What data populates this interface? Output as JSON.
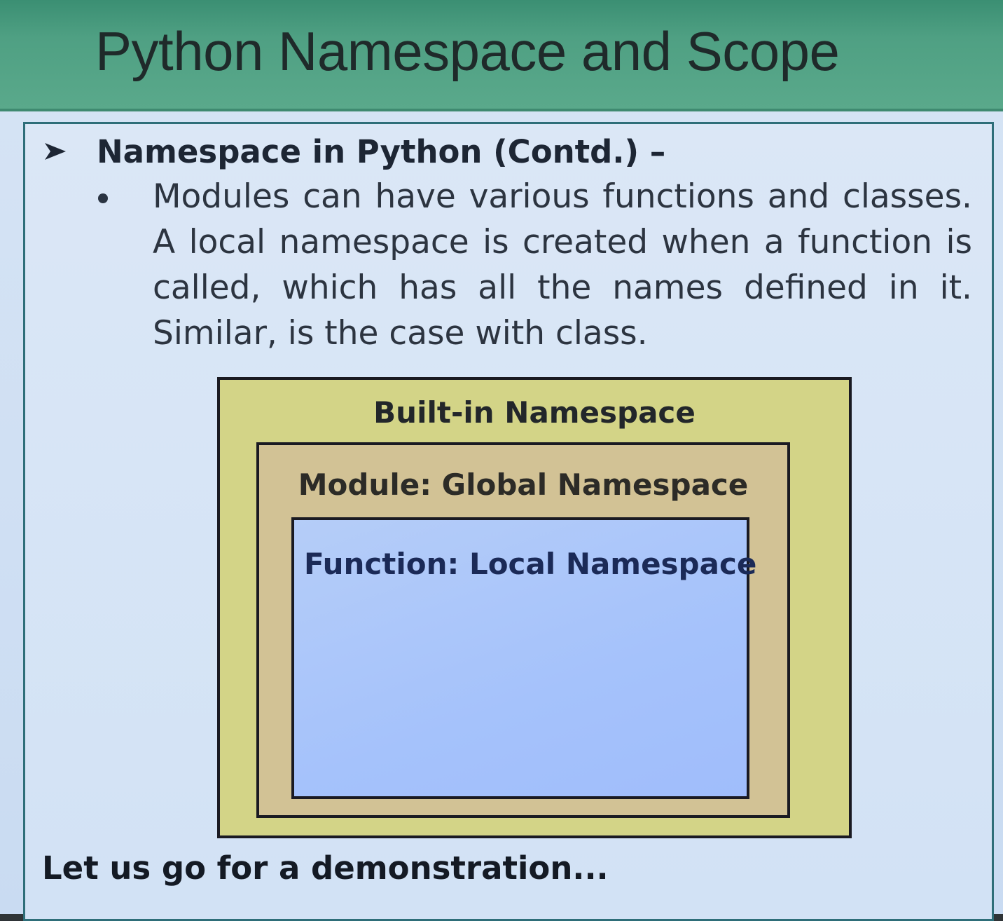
{
  "slide": {
    "title": "Python Namespace and Scope",
    "heading": "Namespace in Python (Contd.) –",
    "bullet_text": "Modules can have various functions and classes. A local namespace is created when a function is called, which has all the names defined in it. Similar, is the case with class.",
    "footer": "Let us go for a demonstration..."
  },
  "diagram": {
    "outer_label": "Built-in Namespace",
    "middle_label": "Module: Global Namespace",
    "inner_label": "Function: Local Namespace"
  },
  "icons": {
    "heading_marker": "arrow-bullet-icon"
  },
  "colors": {
    "title_bar": "#4fa083",
    "builtin_box": "#d3d487",
    "module_box": "#d2c295",
    "function_box": "#a5c2fb",
    "frame_border": "#2e6e79"
  }
}
